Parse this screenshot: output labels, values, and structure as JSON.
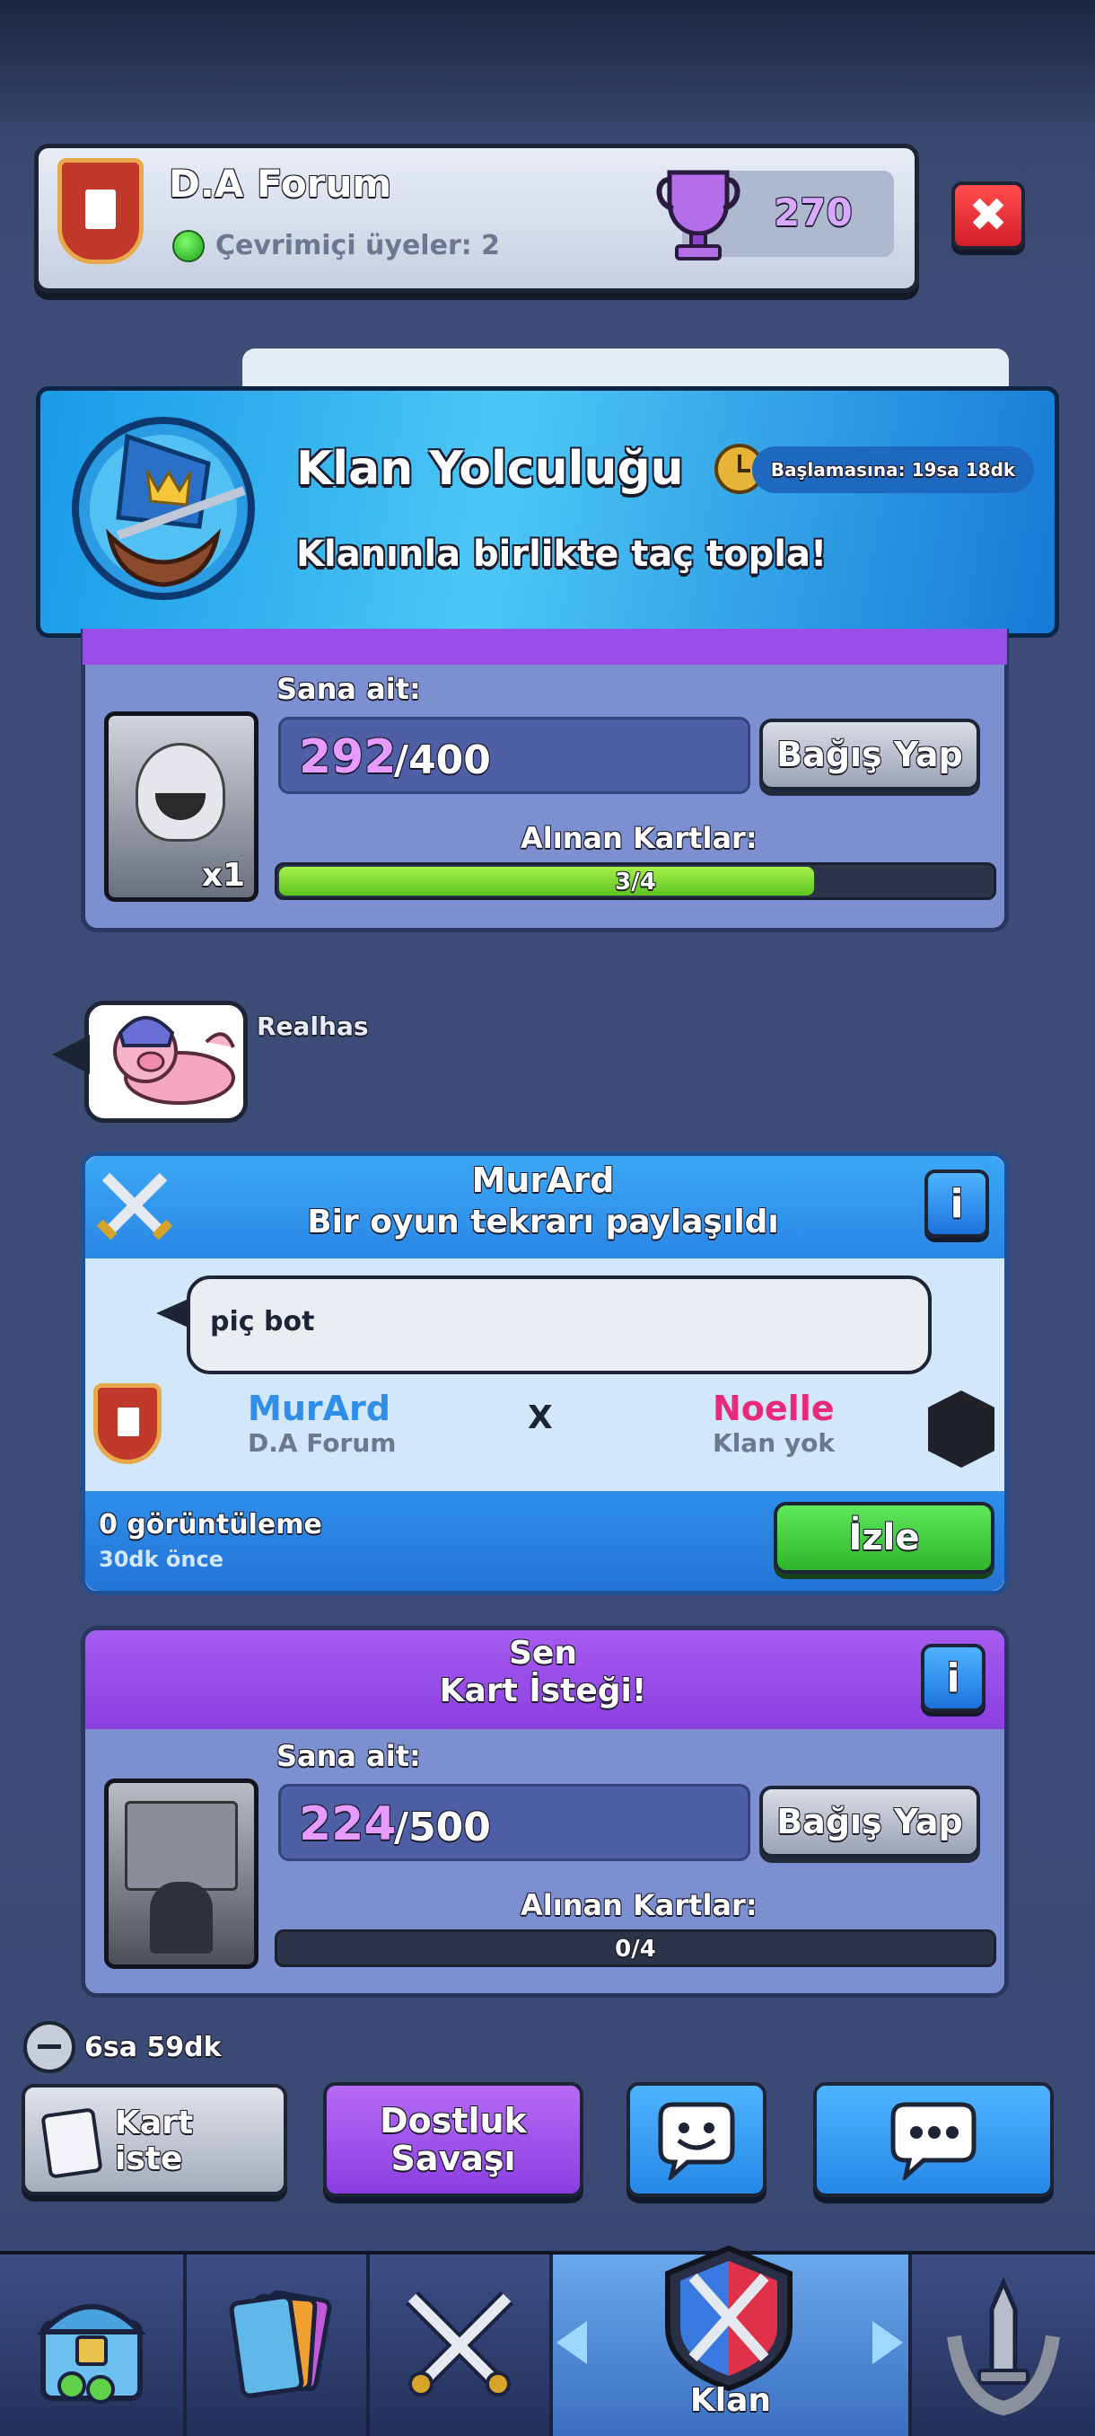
{
  "header": {
    "clan_name": "D.A Forum",
    "online_label": "Çevrimiçi üyeler: 2",
    "trophies": "270",
    "close_icon": "close-icon"
  },
  "banner": {
    "title": "Klan Yolculuğu",
    "timer": "Başlamasına: 19sa 18dk",
    "subtitle": "Klanınla birlikte taç topla!"
  },
  "request1": {
    "yours_label": "Sana ait:",
    "owned": "292",
    "needed": "/400",
    "donate_label": "Bağış Yap",
    "received_label": "Alınan Kartlar:",
    "progress_text": "3/4",
    "progress": 0.75,
    "card_count": "x1"
  },
  "emote": {
    "author": "Realhas"
  },
  "replay": {
    "author": "MurArd",
    "title": "Bir oyun tekrarı paylaşıldı",
    "info_label": "i",
    "comment": "piç bot",
    "player1_name": "MurArd",
    "player1_clan": "D.A Forum",
    "vs": "X",
    "player2_name": "Noelle",
    "player2_clan": "Klan yok",
    "views": "0 görüntüleme",
    "time_ago": "30dk önce",
    "watch_label": "İzle"
  },
  "request2": {
    "author": "Sen",
    "title": "Kart İsteği!",
    "info_label": "i",
    "yours_label": "Sana ait:",
    "owned": "224",
    "needed": "/500",
    "donate_label": "Bağış Yap",
    "received_label": "Alınan Kartlar:",
    "progress_text": "0/4",
    "progress": 0
  },
  "cooldown": {
    "time": "6sa 59dk"
  },
  "actions": {
    "request_label_1": "Kart",
    "request_label_2": "iste",
    "friendly_label_1": "Dostluk",
    "friendly_label_2": "Savaşı"
  },
  "nav": {
    "active_label": "Klan",
    "items": [
      "shop-icon",
      "cards-icon",
      "battle-icon",
      "clan-icon",
      "events-icon"
    ]
  },
  "colors": {
    "purple_header": "#9a4ee8",
    "blue_header": "#2f8fea",
    "green_button": "#3fc63b",
    "panel": "#7c8fd0"
  }
}
